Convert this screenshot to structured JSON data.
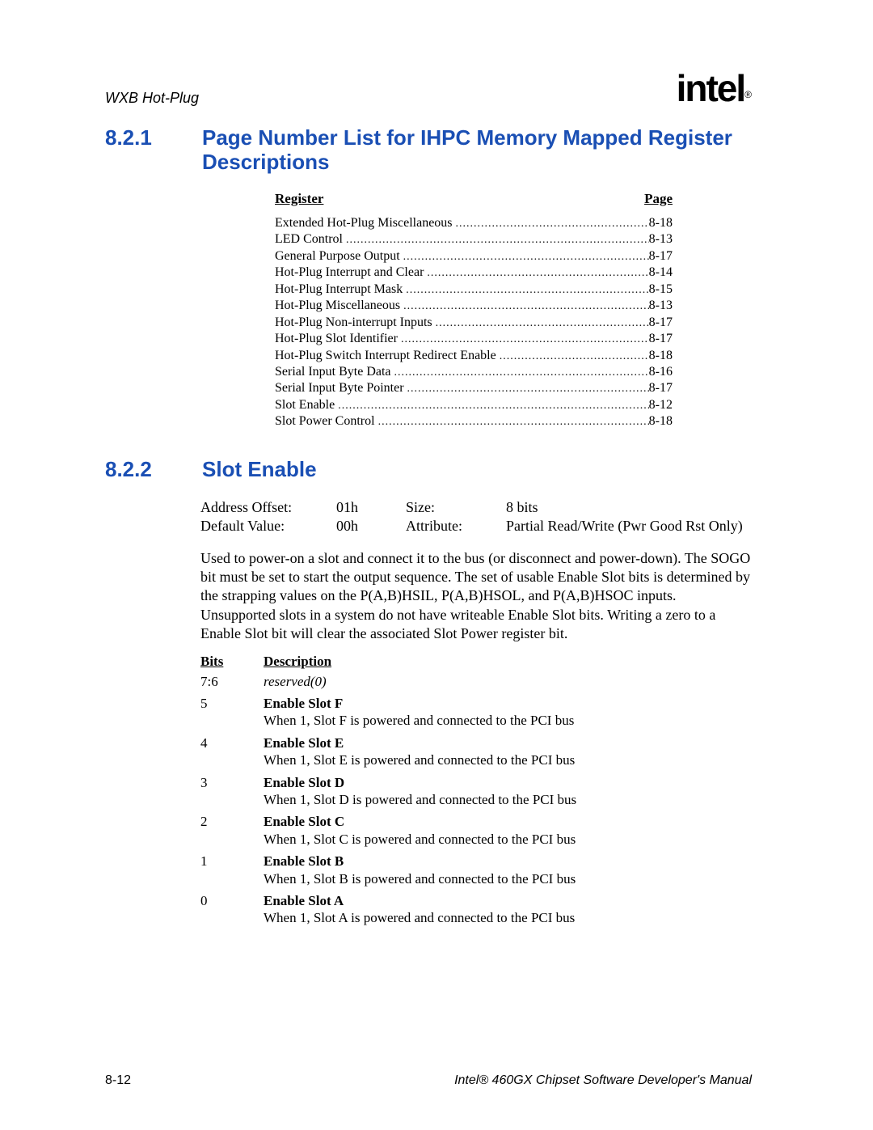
{
  "running_header": "WXB Hot-Plug",
  "logo": {
    "text": "intel",
    "reg": "®"
  },
  "sections": {
    "sec1": {
      "number": "8.2.1",
      "title": "Page Number List for IHPC Memory Mapped Register Descriptions",
      "col_register": "Register",
      "col_page": "Page",
      "rows": [
        {
          "name": "Extended Hot-Plug Miscellaneous",
          "page": "8-18"
        },
        {
          "name": "LED Control",
          "page": "8-13"
        },
        {
          "name": "General Purpose Output",
          "page": "8-17"
        },
        {
          "name": "Hot-Plug Interrupt and Clear",
          "page": "8-14"
        },
        {
          "name": "Hot-Plug Interrupt Mask",
          "page": "8-15"
        },
        {
          "name": "Hot-Plug Miscellaneous",
          "page": "8-13"
        },
        {
          "name": "Hot-Plug Non-interrupt Inputs",
          "page": "8-17"
        },
        {
          "name": "Hot-Plug Slot Identifier",
          "page": "8-17"
        },
        {
          "name": "Hot-Plug Switch Interrupt Redirect Enable",
          "page": "8-18"
        },
        {
          "name": "Serial Input Byte Data",
          "page": "8-16"
        },
        {
          "name": "Serial Input Byte Pointer",
          "page": "8-17"
        },
        {
          "name": "Slot Enable",
          "page": "8-12"
        },
        {
          "name": "Slot Power Control",
          "page": "8-18"
        }
      ]
    },
    "sec2": {
      "number": "8.2.2",
      "title": "Slot Enable",
      "spec": {
        "addr_label": "Address Offset:",
        "addr_value": "01h",
        "size_label": "Size:",
        "size_value": "8 bits",
        "def_label": "Default Value:",
        "def_value": "00h",
        "attr_label": "Attribute:",
        "attr_value": "Partial Read/Write (Pwr Good Rst Only)"
      },
      "paragraph": "Used to power-on a slot and connect it to the bus (or disconnect and power-down). The SOGO bit must be set to start the output sequence. The set of usable Enable Slot bits is determined by the strapping values on the P(A,B)HSIL, P(A,B)HSOL, and P(A,B)HSOC inputs. Unsupported slots in a system do not have writeable Enable Slot bits. Writing a zero to a Enable Slot bit will clear the associated Slot Power register bit.",
      "bits_header": {
        "bits": "Bits",
        "desc": "Description"
      },
      "bits": [
        {
          "bits": "7:6",
          "reserved": "reserved(0)"
        },
        {
          "bits": "5",
          "name": "Enable Slot F",
          "desc": "When 1, Slot F is powered and connected to the PCI bus"
        },
        {
          "bits": "4",
          "name": "Enable Slot E",
          "desc": "When 1, Slot E is powered and connected to the PCI bus"
        },
        {
          "bits": "3",
          "name": "Enable Slot D",
          "desc": "When 1, Slot D is powered and connected to the PCI bus"
        },
        {
          "bits": "2",
          "name": "Enable Slot C",
          "desc": "When 1, Slot C is powered and connected to the PCI bus"
        },
        {
          "bits": "1",
          "name": "Enable Slot B",
          "desc": "When 1, Slot B is powered and connected to the PCI bus"
        },
        {
          "bits": "0",
          "name": "Enable Slot A",
          "desc": "When 1, Slot A is powered and connected to the PCI bus"
        }
      ]
    }
  },
  "footer": {
    "page_no": "8-12",
    "manual_title": "Intel® 460GX Chipset Software Developer's Manual"
  }
}
